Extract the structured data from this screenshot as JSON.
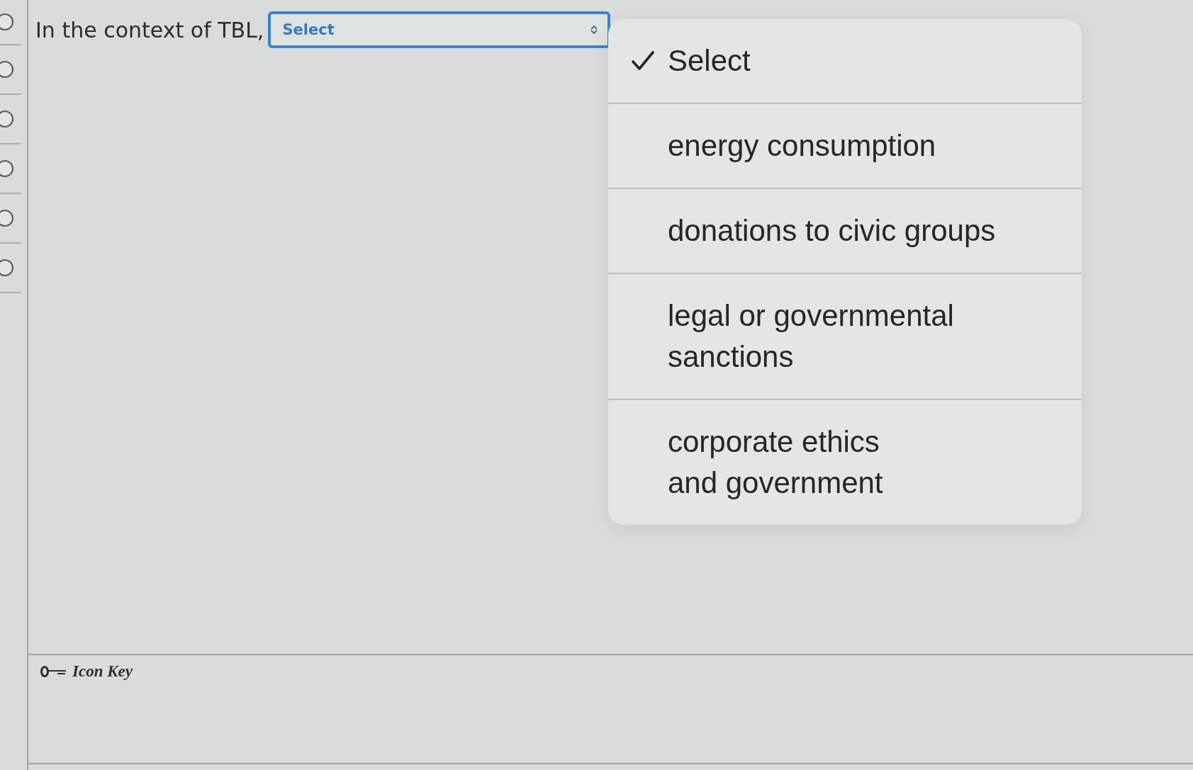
{
  "side_options": [
    {
      "selected": false
    },
    {
      "selected": false
    },
    {
      "selected": false
    },
    {
      "selected": false
    },
    {
      "selected": false
    },
    {
      "selected": false
    }
  ],
  "question": {
    "text": "In the context of TBL,",
    "select": {
      "value": "Select",
      "focused": true,
      "expanded": true
    }
  },
  "dropdown_menu": {
    "options": [
      {
        "label": "Select",
        "selected": true
      },
      {
        "label": "energy consumption",
        "selected": false
      },
      {
        "label": "donations to civic groups",
        "selected": false
      },
      {
        "label": "legal or governmental\nsanctions",
        "selected": false
      },
      {
        "label": "corporate ethics\nand government",
        "selected": false
      }
    ]
  },
  "footer": {
    "label": "Icon Key"
  }
}
